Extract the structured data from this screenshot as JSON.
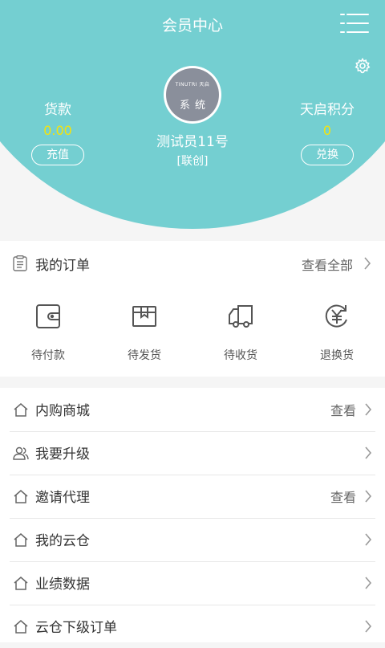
{
  "header": {
    "title": "会员中心"
  },
  "account": {
    "balance_label": "货款",
    "balance_value": "0.00",
    "recharge_label": "充值",
    "points_label": "天启积分",
    "points_value": "0",
    "exchange_label": "兑换"
  },
  "user": {
    "avatar_brand": "TINUTRI 天启",
    "avatar_text": "系统",
    "name": "测试员11号",
    "tag": "[联创]"
  },
  "orders": {
    "title": "我的订单",
    "view_all": "查看全部",
    "items": [
      {
        "label": "待付款",
        "icon": "wallet-icon"
      },
      {
        "label": "待发货",
        "icon": "package-icon"
      },
      {
        "label": "待收货",
        "icon": "truck-icon"
      },
      {
        "label": "退换货",
        "icon": "yuan-refund-icon"
      }
    ]
  },
  "menu": [
    {
      "label": "内购商城",
      "value": "查看",
      "icon": "home-icon"
    },
    {
      "label": "我要升级",
      "value": "",
      "icon": "users-icon"
    },
    {
      "label": "邀请代理",
      "value": "查看",
      "icon": "home-icon"
    },
    {
      "label": "我的云仓",
      "value": "",
      "icon": "home-icon"
    },
    {
      "label": "业绩数据",
      "value": "",
      "icon": "home-icon"
    },
    {
      "label": "云仓下级订单",
      "value": "",
      "icon": "home-icon"
    }
  ],
  "colors": {
    "accent": "#74cfd1",
    "value_yellow": "#f5e30c"
  }
}
